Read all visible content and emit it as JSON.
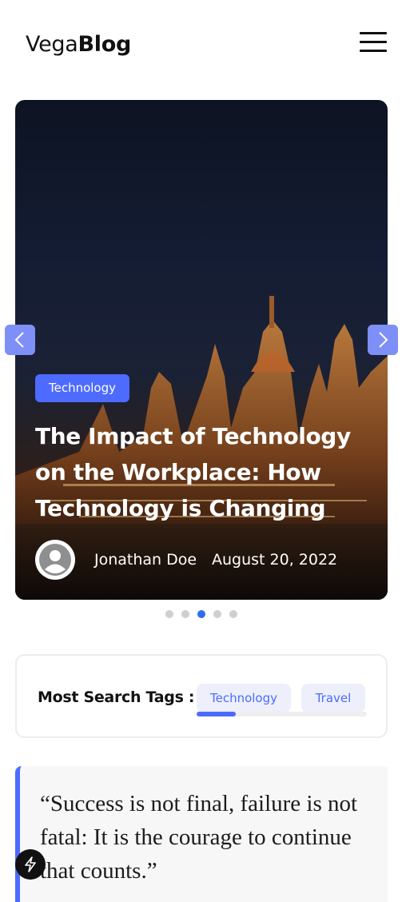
{
  "header": {
    "logo_light": "Vega",
    "logo_bold": "Blog",
    "menu_icon": "hamburger-menu-icon"
  },
  "hero": {
    "category": "Technology",
    "title": "The Impact of Technology on the Workplace: How Technology is Changing",
    "author": "Jonathan Doe",
    "date": "August 20, 2022",
    "prev_icon": "chevron-left-icon",
    "next_icon": "chevron-right-icon",
    "slide_count": 5,
    "active_slide": 3
  },
  "tags": {
    "label": "Most Search Tags :",
    "items": [
      "Technology",
      "Travel"
    ],
    "scroll_position": 0.23
  },
  "quote": {
    "text": "“Success is not final, failure is not fatal: It is the courage to continue that counts.”"
  },
  "colors": {
    "accent": "#4d6bfe",
    "arrow": "#7e8ff7",
    "active_dot": "#2f6ee8"
  }
}
